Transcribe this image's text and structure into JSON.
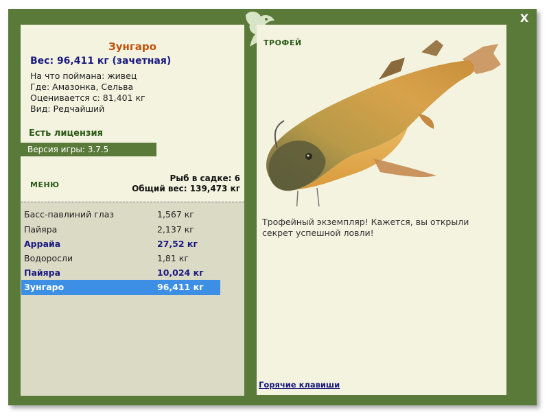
{
  "close_label": "X",
  "fish": {
    "title": "Зунгаро",
    "weight_line": "Вес: 96,411 кг (зачетная)",
    "caught_on": "На что поймана: живец",
    "location": "Где: Амазонка, Сельва",
    "valued_from": "Оценивается с: 81,401 кг",
    "kind": "Вид: Редчайший"
  },
  "license": "Есть лицензия",
  "version": "Версия игры: 3.7.5",
  "menu_label": "МЕНЮ",
  "keepnet": {
    "count": "Рыб в садке: 6",
    "total": "Общий вес: 139,473 кг"
  },
  "catch_list": [
    {
      "name": "Басс-павлиний глаз",
      "weight": "1,567 кг",
      "style": "normal"
    },
    {
      "name": "Пайяра",
      "weight": "2,137 кг",
      "style": "normal"
    },
    {
      "name": "Аррайа",
      "weight": "27,52 кг",
      "style": "bold"
    },
    {
      "name": "Водоросли",
      "weight": "1,81 кг",
      "style": "normal"
    },
    {
      "name": "Пайяра",
      "weight": "10,024 кг",
      "style": "bold"
    },
    {
      "name": "Зунгаро",
      "weight": "96,411 кг",
      "style": "selected"
    }
  ],
  "trophy": {
    "label": "ТРОФЕЙ",
    "description": "Трофейный экземпляр! Кажется, вы открыли секрет успешной ловли!",
    "hotkeys": "Горячие клавиши"
  },
  "colors": {
    "frame": "#5a7a3a",
    "panel": "#f4f3e0",
    "list_bg": "#dbdac5",
    "selected": "#3d8fe6",
    "title": "#c0520a",
    "accent_text": "#1a1a80"
  },
  "icons": [
    "close-icon",
    "fish-logo-icon"
  ]
}
